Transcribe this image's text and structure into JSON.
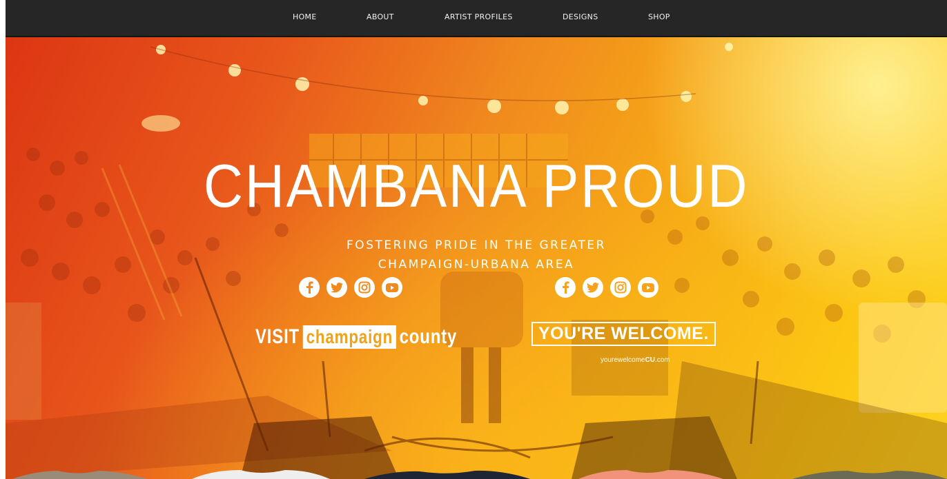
{
  "nav": {
    "items": [
      "HOME",
      "ABOUT",
      "ARTIST PROFILES",
      "DESIGNS",
      "SHOP"
    ]
  },
  "hero": {
    "title": "CHAMBANA PROUD",
    "subtitle_line1": "FOSTERING PRIDE IN THE GREATER",
    "subtitle_line2": "CHAMPAIGN-URBANA AREA",
    "gradient_colors": [
      "#dc3613",
      "#f08a1e",
      "#fcc713"
    ]
  },
  "partners": {
    "visit": {
      "word1": "VISIT",
      "word2": "champaign",
      "word3": "county",
      "social_icons": [
        "facebook-icon",
        "twitter-icon",
        "instagram-icon",
        "youtube-icon"
      ]
    },
    "welcome": {
      "logo_text": "YOU'RE WELCOME.",
      "url_prefix": "yourewelcome",
      "url_bold": "CU",
      "url_suffix": ".com",
      "social_icons": [
        "facebook-icon",
        "twitter-icon",
        "instagram-icon",
        "youtube-icon"
      ]
    }
  },
  "colors": {
    "nav_bg": "#262626",
    "nav_text": "#f2f2f2",
    "accent": "#f2a21a"
  }
}
